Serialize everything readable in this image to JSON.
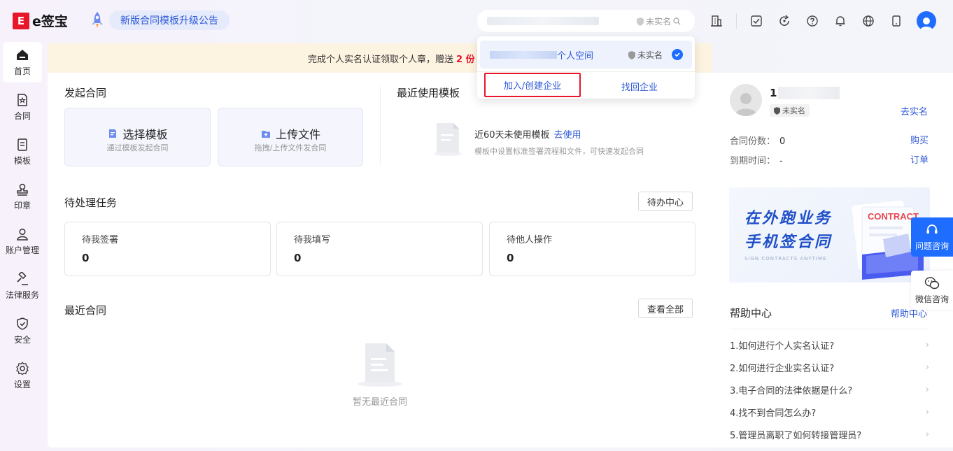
{
  "header": {
    "logo_mark": "E",
    "logo_text": "e签宝",
    "notice": "新版合同模板升级公告",
    "search_status": "未实名",
    "icons": [
      "building-icon",
      "task-check-icon",
      "refresh-icon",
      "help-icon",
      "bell-icon",
      "globe-icon",
      "mobile-icon",
      "user-avatar-icon"
    ]
  },
  "dropdown": {
    "space_name": "个人空间",
    "status": "未实名",
    "join_create": "加入/创建企业",
    "recover": "找回企业"
  },
  "nav": {
    "items": [
      {
        "label": "首页",
        "icon": "home-icon"
      },
      {
        "label": "合同",
        "icon": "contract-icon"
      },
      {
        "label": "模板",
        "icon": "template-icon"
      },
      {
        "label": "印章",
        "icon": "seal-icon"
      },
      {
        "label": "账户管理",
        "icon": "account-icon"
      },
      {
        "label": "法律服务",
        "icon": "legal-icon"
      },
      {
        "label": "安全",
        "icon": "shield-icon"
      },
      {
        "label": "设置",
        "icon": "gear-icon"
      }
    ]
  },
  "banner": {
    "text": "完成个人实名认证领取个人章，赠送",
    "highlight": "2 份"
  },
  "start": {
    "title": "发起合同",
    "choose_title": "选择模板",
    "choose_sub": "通过模板发起合同",
    "upload_title": "上传文件",
    "upload_sub": "拖拽/上传文件发合同"
  },
  "templates": {
    "title": "最近使用模板",
    "empty_line": "近60天未使用模板",
    "use_link": "去使用",
    "hint": "模板中设置标准签署流程和文件，可快速发起合同"
  },
  "tasks": {
    "title": "待处理任务",
    "center_button": "待办中心",
    "cards": [
      {
        "label": "待我签署",
        "count": "0"
      },
      {
        "label": "待我填写",
        "count": "0"
      },
      {
        "label": "待他人操作",
        "count": "0"
      }
    ]
  },
  "recent": {
    "title": "最近合同",
    "view_all": "查看全部",
    "empty": "暂无最近合同"
  },
  "profile": {
    "name_initial": "1",
    "status": "未实名",
    "verify_link": "去实名",
    "count_label": "合同份数：",
    "count_value": "0",
    "buy_link": "购买",
    "expire_label": "到期时间：",
    "expire_value": "-",
    "order_link": "订单"
  },
  "promo": {
    "line1": "在外跑业务",
    "line2": "手机签合同",
    "sub": "SIGN CONTRACTS ANYTIME",
    "doc_label": "CONTRACT"
  },
  "help": {
    "title": "帮助中心",
    "link": "帮助中心",
    "items": [
      "1.如何进行个人实名认证?",
      "2.如何进行企业实名认证?",
      "3.电子合同的法律依据是什么?",
      "4.找不到合同怎么办?",
      "5.管理员离职了如何转接管理员?"
    ]
  },
  "float": {
    "consult": "问题咨询",
    "wechat": "微信咨询"
  },
  "colors": {
    "brand_red": "#e8162a",
    "accent_blue": "#1f6dff",
    "link_blue": "#2e59d8",
    "banner_bg": "#fdf3e1"
  }
}
